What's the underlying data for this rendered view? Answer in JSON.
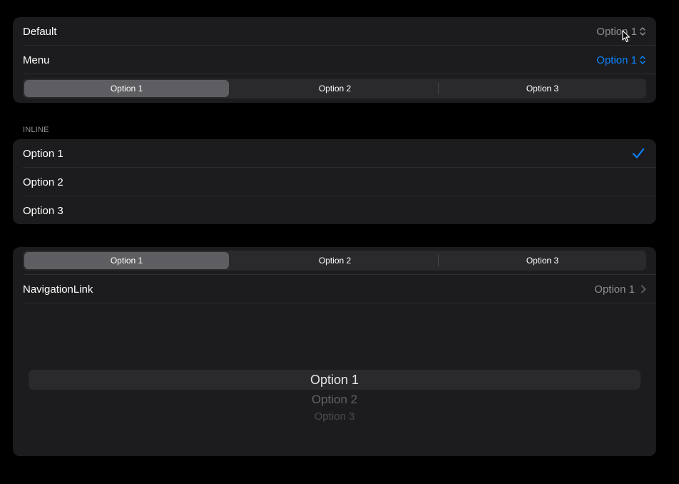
{
  "picker_styles": {
    "default": {
      "label": "Default",
      "value": "Option 1"
    },
    "menu": {
      "label": "Menu",
      "value": "Option 1"
    },
    "segmented": {
      "options": [
        "Option 1",
        "Option 2",
        "Option 3"
      ],
      "selected": "Option 1"
    }
  },
  "inline": {
    "header": "INLINE",
    "items": [
      "Option 1",
      "Option 2",
      "Option 3"
    ],
    "selected": "Option 1"
  },
  "bottom": {
    "segmented": {
      "options": [
        "Option 1",
        "Option 2",
        "Option 3"
      ],
      "selected": "Option 1"
    },
    "navigation_link": {
      "label": "NavigationLink",
      "value": "Option 1"
    },
    "wheel": {
      "items": [
        "Option 1",
        "Option 2",
        "Option 3"
      ],
      "selected": "Option 1"
    }
  },
  "colors": {
    "accent": "#0a84ff",
    "secondary_text": "#8e8e93",
    "background": "#000000",
    "group": "#1c1c1e"
  },
  "icons": {
    "updown": "chevron-up-down-icon",
    "check": "checkmark-icon",
    "disclosure": "chevron-right-icon",
    "cursor": "mouse-pointer-icon"
  }
}
